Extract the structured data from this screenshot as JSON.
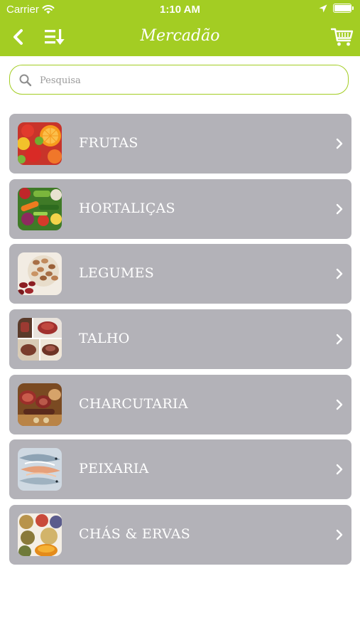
{
  "status_bar": {
    "carrier": "Carrier",
    "time": "1:10 AM",
    "battery_level": 0.95
  },
  "navbar": {
    "title": "Mercadão",
    "back_icon": "chevron-left-icon",
    "sort_icon": "sort-list-icon",
    "cart_icon": "shopping-cart-icon"
  },
  "search": {
    "placeholder": "Pesquisa",
    "value": ""
  },
  "colors": {
    "accent": "#a3cd23",
    "row_background": "#b3b2b8",
    "text_on_row": "#ffffff"
  },
  "categories": [
    {
      "label": "FRUTAS",
      "image": "fruits-photo"
    },
    {
      "label": "HORTALIÇAS",
      "image": "vegetables-photo"
    },
    {
      "label": "LEGUMES",
      "image": "beans-photo"
    },
    {
      "label": "TALHO",
      "image": "meat-photo"
    },
    {
      "label": "CHARCUTARIA",
      "image": "cured-meats-photo"
    },
    {
      "label": "PEIXARIA",
      "image": "fish-photo"
    },
    {
      "label": "CHÁS & ERVAS",
      "image": "tea-herbs-photo"
    }
  ]
}
